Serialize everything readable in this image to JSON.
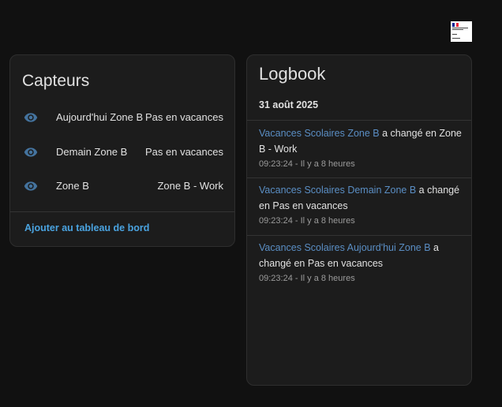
{
  "logo": {
    "icon": "government-logo-icon"
  },
  "capteurs": {
    "title": "Capteurs",
    "rows": [
      {
        "icon": "eye-icon",
        "name": "Aujourd'hui Zone B",
        "state": "Pas en vacances"
      },
      {
        "icon": "eye-icon",
        "name": "Demain Zone B",
        "state": "Pas en vacances"
      },
      {
        "icon": "eye-icon",
        "name": "Zone B",
        "state": "Zone B - Work"
      }
    ],
    "add_link": "Ajouter au tableau de bord"
  },
  "logbook": {
    "title": "Logbook",
    "date": "31 août 2025",
    "entries": [
      {
        "entity": "Vacances Scolaires Zone B",
        "message": " a changé en Zone B - Work",
        "time": "09:23:24 - Il y a 8 heures"
      },
      {
        "entity": "Vacances Scolaires Demain Zone B",
        "message": " a changé en Pas en vacances",
        "time": "09:23:24 - Il y a 8 heures"
      },
      {
        "entity": "Vacances Scolaires Aujourd'hui Zone B",
        "message": " a changé en Pas en vacances",
        "time": "09:23:24 - Il y a 8 heures"
      }
    ]
  },
  "colors": {
    "background": "#111111",
    "card": "#1c1c1c",
    "link": "#4aa3e0",
    "entity_link": "#5a8ec4",
    "icon": "#44739e"
  }
}
